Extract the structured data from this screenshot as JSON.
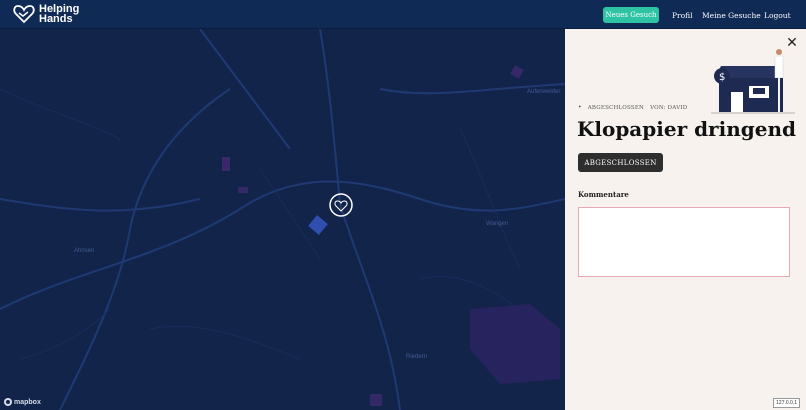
{
  "header": {
    "logo_text": "Helping Hands",
    "new_request_label": "Neues Gesuch",
    "profile_label": "Profil",
    "my_requests_label": "Meine Gesuche",
    "logout_label": "Logout"
  },
  "map": {
    "places": [
      "Aufenwelder",
      "Ahnsen",
      "Wangen",
      "Riedern"
    ],
    "attribution": "mapbox"
  },
  "panel": {
    "status": "ABGESCHLOSSEN",
    "author": "VON: DAVID",
    "title": "Klopapier dringend",
    "status_button_label": "ABGESCHLOSSEN",
    "comments_label": "Kommentare",
    "comments_value": ""
  },
  "footer": {
    "ip": "127.0.0.1"
  },
  "colors": {
    "navbar": "#0f2a55",
    "accent": "#2ec4a3",
    "map_background": "#13244a",
    "panel_background": "#f7f2ee"
  }
}
